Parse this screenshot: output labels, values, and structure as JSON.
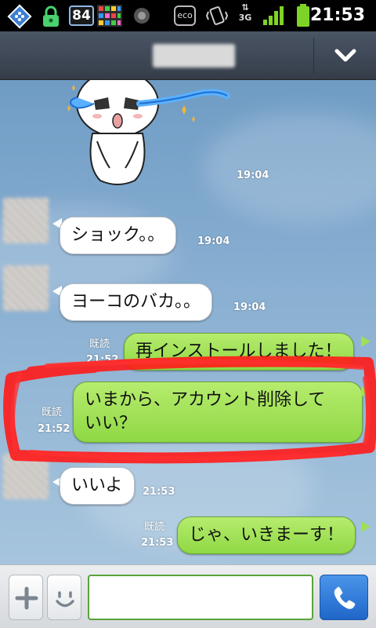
{
  "status_bar": {
    "badge_count": "84",
    "eco_label": "eco",
    "network_label": "3G",
    "time": "21:53"
  },
  "header": {
    "title": ""
  },
  "messages": [
    {
      "side": "in",
      "text": "ショック。。",
      "time": "19:04"
    },
    {
      "side": "in",
      "text": "ヨーコのバカ。。",
      "time": "19:04"
    },
    {
      "side": "out",
      "text": "再インストールしました！",
      "time": "21:52",
      "read": "既読"
    },
    {
      "side": "out",
      "text_line1": "いまから、アカウント削除して",
      "text_line2": "いい？",
      "time": "21:52",
      "read": "既読"
    },
    {
      "side": "in",
      "text": "いいよ",
      "time": "21:53"
    },
    {
      "side": "out",
      "text": "じゃ、いきまーす！",
      "time": "21:53",
      "read": "既読"
    }
  ],
  "sticker": {
    "time": "19:04",
    "icon": "crying-character-sticker"
  },
  "input_bar": {
    "text_value": "",
    "icons": [
      "plus-icon",
      "smiley-icon",
      "phone-icon"
    ]
  },
  "colors": {
    "outgoing_bubble": "#9edf55",
    "incoming_bubble": "#ffffff",
    "header_bg": "#3f4855",
    "send_button": "#2f7fdb",
    "annotation_scribble": "#ff1a1a"
  }
}
